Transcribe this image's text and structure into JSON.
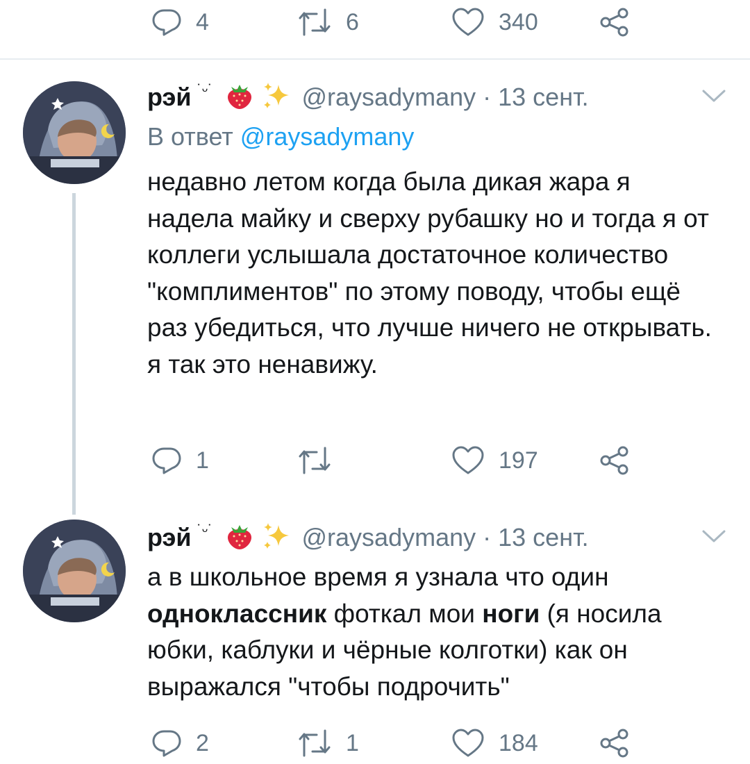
{
  "top_actions": {
    "replies": "4",
    "retweets": "6",
    "likes": "340"
  },
  "tweet1": {
    "name": "рэй",
    "kaomoji": "˙ᵕ˙",
    "handle": "@raysadymany",
    "separator": "·",
    "date": "13 сент.",
    "reply_label": "В ответ",
    "reply_handle": "@raysadymany",
    "text": "недавно летом когда была дикая жара я надела майку и сверху рубашку но и тогда я от коллеги услышала достаточное количество \"комплиментов\" по этому поводу, чтобы ещё раз убедиться, что лучше ничего не открывать. я так это ненавижу.",
    "actions": {
      "replies": "1",
      "retweets": "",
      "likes": "197"
    }
  },
  "tweet2": {
    "name": "рэй",
    "kaomoji": "˙ᵕ˙",
    "handle": "@raysadymany",
    "separator": "·",
    "date": "13 сент.",
    "text_parts": [
      "а в школьное время я узнала что один ",
      "одноклассник",
      " фоткал мои ",
      "ноги",
      " (я носила юбки, каблуки и чёрные колготки) как он выражался \"чтобы подрочить\""
    ],
    "actions": {
      "replies": "2",
      "retweets": "1",
      "likes": "184"
    }
  },
  "colors": {
    "text": "#14171a",
    "secondary": "#657786",
    "link": "#1da1f2",
    "divider": "#e6ecf0",
    "thread": "#ccd6dd"
  },
  "icons": [
    "reply-icon",
    "retweet-icon",
    "like-icon",
    "share-icon",
    "chevron-down-icon",
    "strawberry-icon",
    "sparkles-icon"
  ]
}
